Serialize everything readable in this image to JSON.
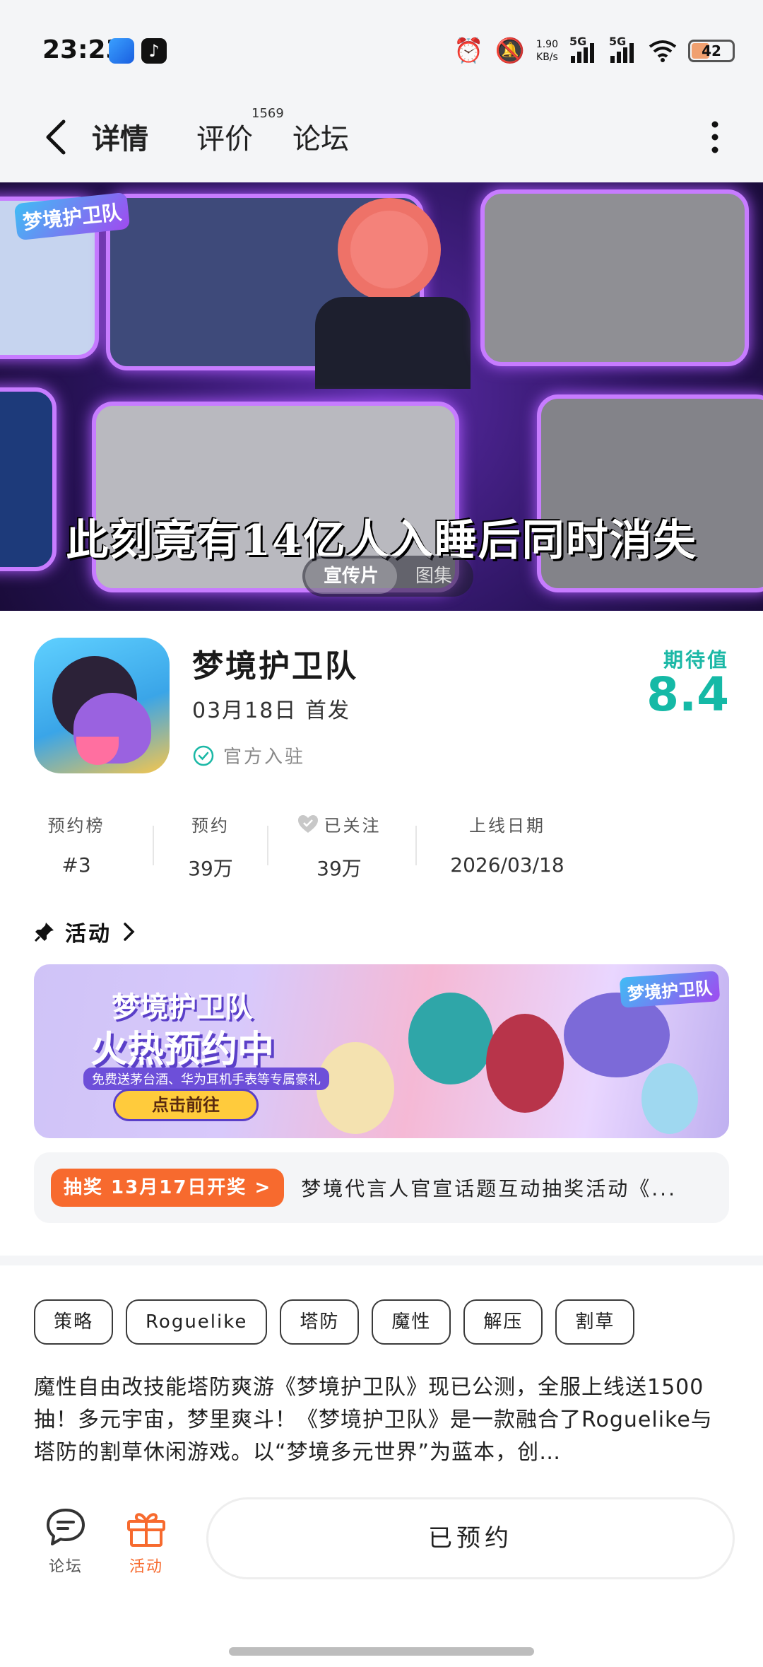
{
  "status_bar": {
    "time": "23:23",
    "net_speed_value": "1.90",
    "net_speed_unit": "KB/s",
    "network_1": "5G",
    "network_2": "5G",
    "battery": "42"
  },
  "nav": {
    "tabs": [
      {
        "label": "详情"
      },
      {
        "label": "评价"
      },
      {
        "label": "论坛"
      }
    ],
    "review_count": "1569"
  },
  "banner": {
    "caption": "此刻竟有14亿人入睡后同时消失",
    "brand": "梦境护卫队",
    "media_tabs": [
      "宣传片",
      "图集"
    ]
  },
  "game": {
    "title": "梦境护卫队",
    "release": "03月18日 首发",
    "official_label": "官方入驻",
    "expect_label": "期待值",
    "expect_score": "8.4"
  },
  "stats": [
    {
      "label": "预约榜",
      "value": "#3"
    },
    {
      "label": "预约",
      "value": "39万"
    },
    {
      "label": "已关注",
      "value": "39万"
    },
    {
      "label": "上线日期",
      "value": "2026/03/18"
    }
  ],
  "activity": {
    "title": "活动",
    "promo": {
      "title_line1": "梦境护卫队",
      "title_line2": "火热预约中",
      "subtitle": "免费送茅台酒、华为耳机手表等专属豪礼",
      "button": "点击前往",
      "logo": "梦境护卫队"
    },
    "lottery": {
      "pill": "抽奖 13月17日开奖 >",
      "text": "梦境代言人官宣话题互动抽奖活动《..."
    }
  },
  "tags": [
    "策略",
    "Roguelike",
    "塔防",
    "魔性",
    "解压",
    "割草"
  ],
  "description": "魔性自由改技能塔防爽游《梦境护卫队》现已公测，全服上线送1500抽！多元宇宙，梦里爽斗！《梦境护卫队》是一款融合了Roguelike与塔防的割草休闲游戏。以“梦境多元世界”为蓝本，创…",
  "bottom_bar": {
    "forum": "论坛",
    "activity": "活动",
    "reserve": "已预约"
  },
  "colors": {
    "accent_teal": "#15b9a6",
    "accent_orange": "#f76a2e"
  }
}
